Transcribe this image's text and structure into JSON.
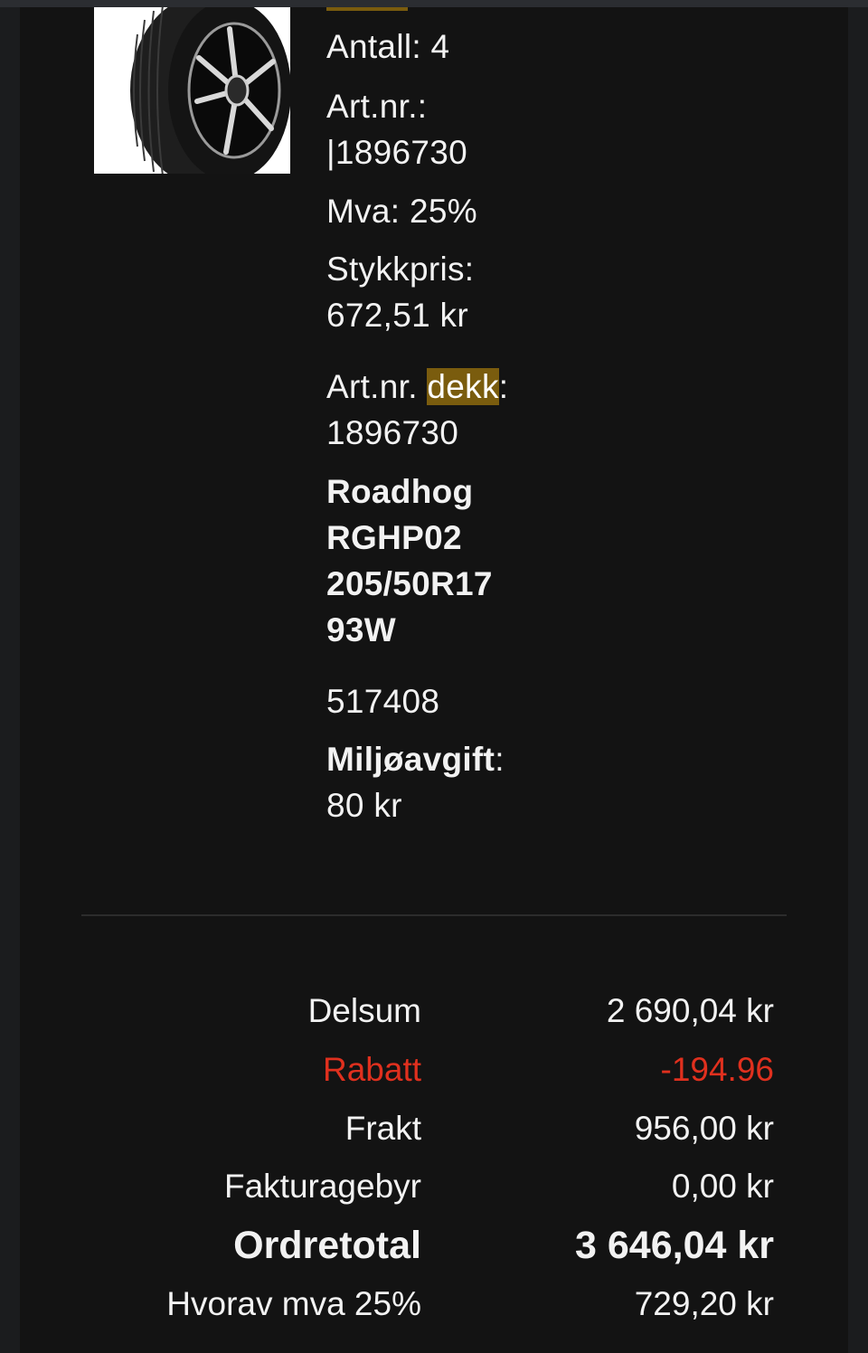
{
  "product": {
    "image_icon": "tire-with-black-rim-image",
    "quantity": "Antall: 4",
    "artnr_label": "Art.nr.:",
    "artnr_value": "|1896730",
    "vat": "Mva: 25%",
    "unit_price_label": "Stykkpris:",
    "unit_price_value": "672,51 kr",
    "tire_artnr_prefix": "Art.nr. ",
    "tire_artnr_highlight": "dekk",
    "tire_artnr_suffix": ":",
    "tire_artnr_value": "1896730",
    "name_lines": [
      "Roadhog",
      "RGHP02",
      "205/50R17",
      "93W"
    ],
    "code": "517408",
    "env_fee_label": "Miljøavgift",
    "env_fee_colon": ":",
    "env_fee_value": "80 kr"
  },
  "summary": {
    "subtotal_label": "Delsum",
    "subtotal_value": "2 690,04 kr",
    "discount_label": "Rabatt",
    "discount_value": "-194.96",
    "shipping_label": "Frakt",
    "shipping_value": "956,00 kr",
    "invoice_fee_label": "Fakturagebyr",
    "invoice_fee_value": "0,00 kr",
    "total_label": "Ordretotal",
    "total_value": "3 646,04 kr",
    "vat_label": "Hvorav mva 25%",
    "vat_value": "729,20 kr"
  },
  "colors": {
    "highlight": "#7a5c0e",
    "discount": "#e0301e",
    "background": "#131313"
  }
}
